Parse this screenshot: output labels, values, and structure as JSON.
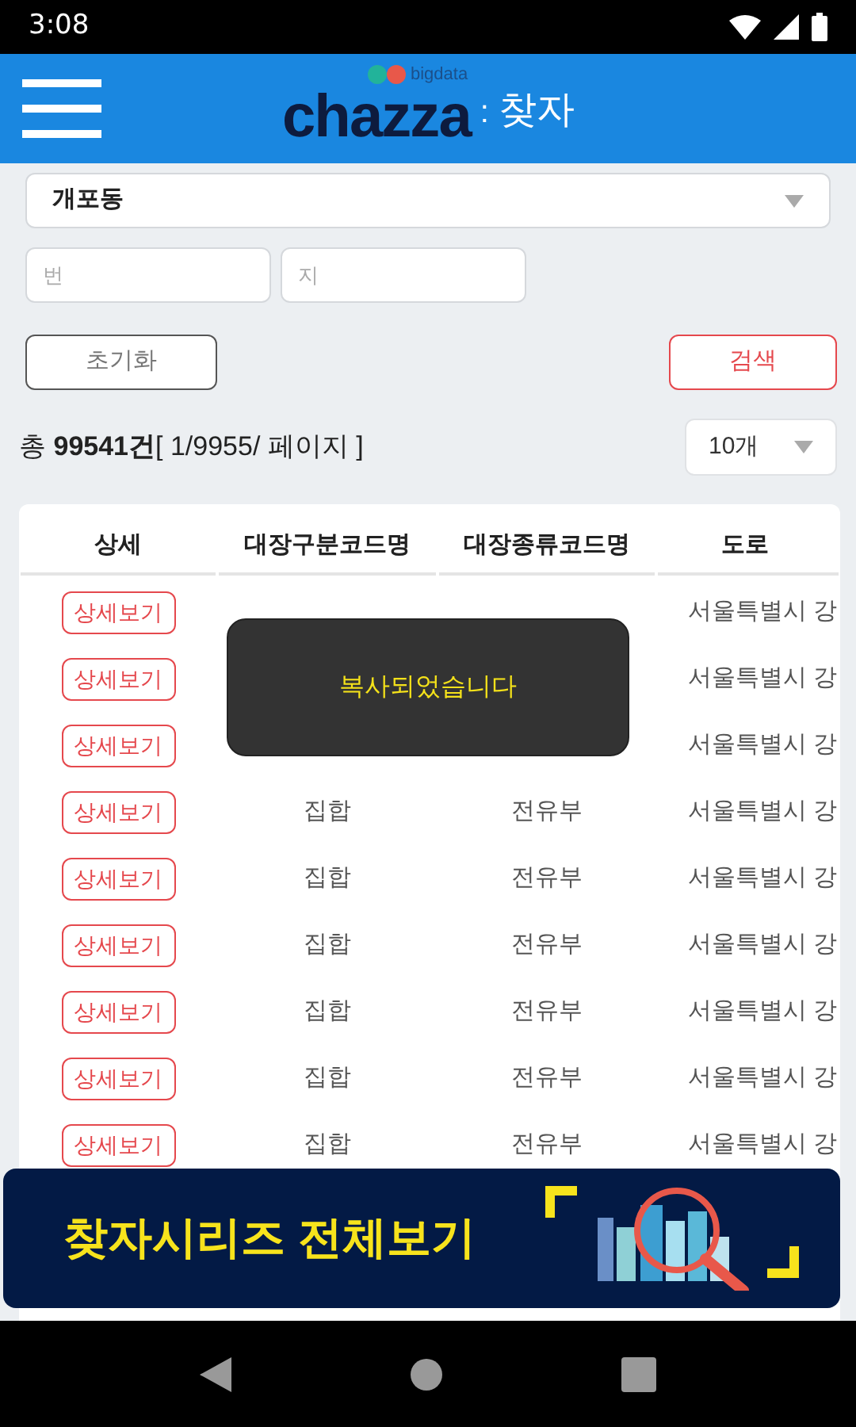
{
  "status_bar": {
    "time": "3:08"
  },
  "header": {
    "logo_tag": "bigdata",
    "logo": "chazza",
    "separator": ":",
    "title": "찾자"
  },
  "form": {
    "dong_select": {
      "value": "개포동"
    },
    "bun_field": {
      "placeholder": "번"
    },
    "ji_field": {
      "placeholder": "지"
    },
    "reset_button": "초기화",
    "search_button": "검색"
  },
  "summary": {
    "text": "총 **99541건**[ 1/9955/ 페이지 ]",
    "page_size": "10개"
  },
  "table": {
    "columns": [
      "상세",
      "대장구분코드명",
      "대장종류코드명",
      "도로"
    ],
    "rows": [
      {
        "detail": "상세보기",
        "road": "서울특별시 강"
      },
      {
        "detail": "상세보기",
        "road": "서울특별시 강"
      },
      {
        "detail": "상세보기",
        "road": "서울특별시 강"
      },
      {
        "detail": "상세보기",
        "column_2": "집합",
        "column_3": "전유부",
        "road": "서울특별시 강"
      },
      {
        "detail": "상세보기",
        "column_2": "집합",
        "column_3": "전유부",
        "road": "서울특별시 강"
      },
      {
        "detail": "상세보기",
        "column_2": "집합",
        "column_3": "전유부",
        "road": "서울특별시 강"
      },
      {
        "detail": "상세보기",
        "column_2": "집합",
        "column_3": "전유부",
        "road": "서울특별시 강"
      },
      {
        "detail": "상세보기",
        "column_2": "집합",
        "column_3": "전유부",
        "road": "서울특별시 강"
      },
      {
        "detail": "상세보기",
        "column_2": "집합",
        "column_3": "전유부",
        "road": "서울특별시 강"
      }
    ]
  },
  "toast": "복사되었습니다",
  "banner": {
    "text": "찾자시리즈 전체보기"
  }
}
